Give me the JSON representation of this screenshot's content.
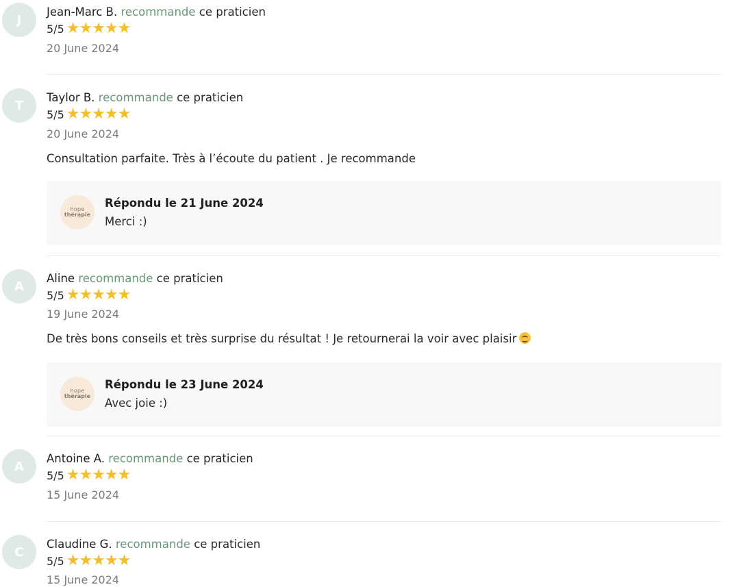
{
  "recommend_word": "recommande",
  "recommend_suffix": "ce praticien",
  "colors": {
    "accent": "#6a9679",
    "stars": "#f4bd2a",
    "avatar_bg": "#dfeae4"
  },
  "reviews": [
    {
      "initial": "J",
      "name": "Jean-Marc B.",
      "score": "5/5",
      "stars": 5,
      "stars_text": "★★★★★",
      "date": "20 June 2024"
    },
    {
      "initial": "T",
      "name": "Taylor B.",
      "score": "5/5",
      "stars": 5,
      "stars_text": "★★★★★",
      "date": "20 June 2024",
      "comment": "Consultation parfaite. Très à l’écoute du patient . Je recommande",
      "reply": {
        "logo_line1": "hope",
        "logo_line2": "thérapie",
        "title": "Répondu le 21 June 2024",
        "text": "Merci :)"
      }
    },
    {
      "initial": "A",
      "name": "Aline",
      "score": "5/5",
      "stars": 5,
      "stars_text": "★★★★★",
      "date": "19 June 2024",
      "comment": "De très bons conseils et très surprise du résultat ! Je retournerai la voir avec plaisir",
      "reply": {
        "logo_line1": "hope",
        "logo_line2": "thérapie",
        "title": "Répondu le 23 June 2024",
        "text": "Avec joie :)"
      }
    },
    {
      "initial": "A",
      "name": "Antoine A.",
      "score": "5/5",
      "stars": 5,
      "stars_text": "★★★★★",
      "date": "15 June 2024"
    },
    {
      "initial": "C",
      "name": "Claudine G.",
      "score": "5/5",
      "stars": 5,
      "stars_text": "★★★★★",
      "date": "15 June 2024"
    }
  ]
}
